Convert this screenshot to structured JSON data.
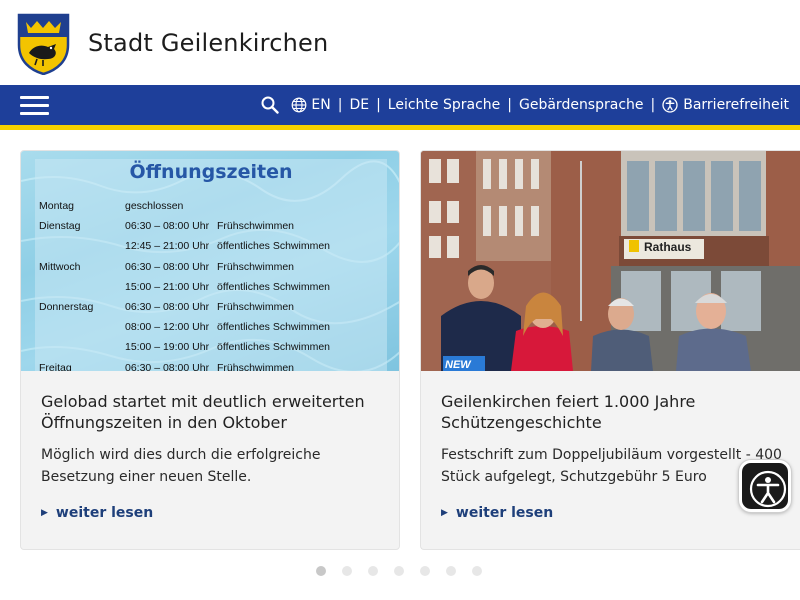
{
  "header": {
    "site_title": "Stadt Geilenkirchen",
    "logo_name": "coat-of-arms"
  },
  "nav": {
    "menu_icon": "hamburger-menu-icon",
    "search_icon": "search-icon",
    "lang_en": "EN",
    "lang_de": "DE",
    "separator": "|",
    "easy_language": "Leichte Sprache",
    "sign_language": "Gebärdensprache",
    "accessibility": "Barrierefreiheit"
  },
  "colors": {
    "nav_blue": "#1e3f9a",
    "accent_yellow": "#f6d100",
    "link_blue": "#1e3f7a"
  },
  "cards": [
    {
      "image": {
        "heading": "Öffnungszeiten",
        "schedule": [
          {
            "day": "Montag",
            "time": "geschlossen",
            "desc": ""
          },
          {
            "day": "Dienstag",
            "time": "06:30 – 08:00 Uhr",
            "desc": "Frühschwimmen"
          },
          {
            "day": "",
            "time": "12:45 – 21:00 Uhr",
            "desc": "öffentliches Schwimmen"
          },
          {
            "day": "Mittwoch",
            "time": "06:30 – 08:00 Uhr",
            "desc": "Frühschwimmen"
          },
          {
            "day": "",
            "time": "15:00 – 21:00 Uhr",
            "desc": "öffentliches Schwimmen"
          },
          {
            "day": "Donnerstag",
            "time": "06:30 – 08:00 Uhr",
            "desc": "Frühschwimmen"
          },
          {
            "day": "",
            "time": "08:00 – 12:00 Uhr",
            "desc": "öffentliches Schwimmen"
          },
          {
            "day": "",
            "time": "15:00 – 19:00 Uhr",
            "desc": "öffentliches Schwimmen"
          },
          {
            "day": "Freitag",
            "time": "06:30 – 08:00 Uhr",
            "desc": "Frühschwimmen"
          }
        ]
      },
      "title": "Gelobad startet mit deutlich erweiterten Öffnungszeiten in den Oktober",
      "text": "Möglich wird dies durch die erfolgreiche Besetzung einer neuen Stelle.",
      "link": "weiter lesen"
    },
    {
      "image": {
        "sign_text": "Rathaus",
        "badge_text": "NEW"
      },
      "title": "Geilenkirchen feiert 1.000 Jahre Schützengeschichte",
      "text": "Festschrift zum Doppeljubiläum vorgestellt - 400 Stück aufgelegt, Schutzgebühr 5 Euro",
      "link": "weiter lesen"
    }
  ],
  "pagination": {
    "total": 7,
    "active": 1
  },
  "a11y_button": {
    "icon": "accessibility-person-icon"
  }
}
